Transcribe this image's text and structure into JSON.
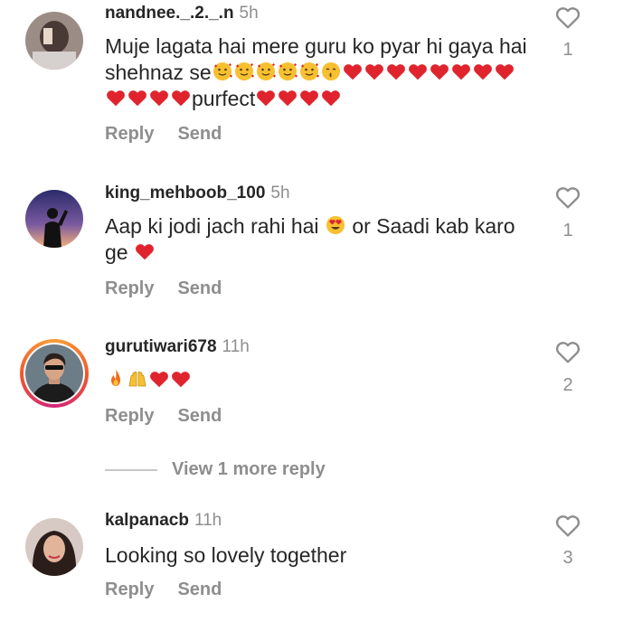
{
  "comments": [
    {
      "username": "nandnee._.2._.n",
      "time": "5h",
      "text_parts": [
        "Muje lagata hai mere guru ko pyar hi gaya hai shehnaz se",
        "purfect"
      ],
      "likes": "1",
      "reply_label": "Reply",
      "send_label": "Send",
      "emoji_a": [
        "smiling-hearts-face",
        "smiling-hearts-face",
        "smiling-hearts-face",
        "smiling-hearts-face",
        "smiling-hearts-face",
        "kissing-face",
        "red-heart",
        "red-heart",
        "red-heart",
        "red-heart",
        "red-heart",
        "red-heart",
        "red-heart",
        "red-heart",
        "red-heart",
        "red-heart",
        "red-heart",
        "red-heart"
      ],
      "emoji_b": [
        "red-heart",
        "red-heart",
        "red-heart",
        "red-heart"
      ]
    },
    {
      "username": "king_mehboob_100",
      "time": "5h",
      "text_parts": [
        "Aap ki jodi jach rahi hai",
        "or  Saadi kab karo ge"
      ],
      "likes": "1",
      "reply_label": "Reply",
      "send_label": "Send",
      "emoji_a": [
        "heart-eyes-face"
      ],
      "emoji_b": [
        "red-heart"
      ]
    },
    {
      "username": "gurutiwari678",
      "time": "11h",
      "text_parts": [],
      "likes": "2",
      "reply_label": "Reply",
      "send_label": "Send",
      "emoji_a": [
        "fire",
        "raising-hands",
        "red-heart",
        "red-heart"
      ]
    },
    {
      "username": "kalpanacb",
      "time": "11h",
      "text_parts": [
        "Looking so lovely together"
      ],
      "likes": "3",
      "reply_label": "Reply",
      "send_label": "Send"
    }
  ],
  "view_more_label": "View 1 more reply",
  "colors": {
    "text": "#262626",
    "muted": "#8e8e8e",
    "heart": "#e0242e",
    "ring": "#d3237a"
  }
}
